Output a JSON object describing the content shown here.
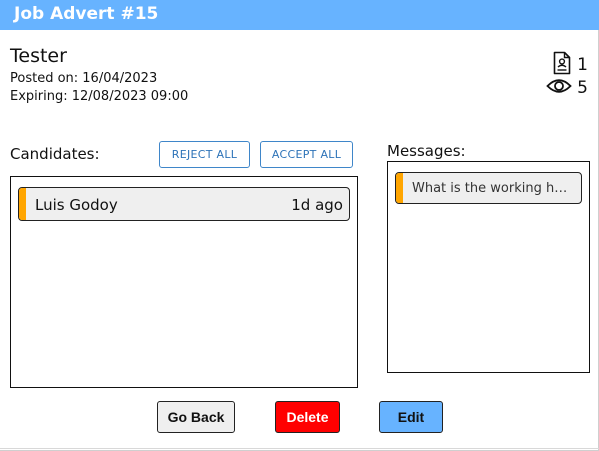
{
  "header": {
    "title": "Job Advert #15",
    "background_color": "#67b3ff"
  },
  "job": {
    "title": "Tester",
    "posted_on": "Posted on: 16/04/2023",
    "expiring": "Expiring: 12/08/2023 09:00"
  },
  "stats": {
    "applicants_icon": "document-user-icon",
    "applicants_count": "1",
    "views_icon": "eye-icon",
    "views_count": "5"
  },
  "candidates": {
    "label": "Candidates:",
    "reject_all_label": "REJECT ALL",
    "accept_all_label": "ACCEPT ALL",
    "items": [
      {
        "name": "Luis Godoy",
        "time": "1d ago",
        "status_color": "#ffa500"
      }
    ]
  },
  "messages": {
    "label": "Messages:",
    "items": [
      {
        "preview": "What is the working hours?",
        "status_color": "#ffa500"
      }
    ]
  },
  "actions": {
    "go_back_label": "Go Back",
    "delete_label": "Delete",
    "edit_label": "Edit",
    "delete_color": "#ff0000",
    "edit_color": "#67b3ff"
  }
}
